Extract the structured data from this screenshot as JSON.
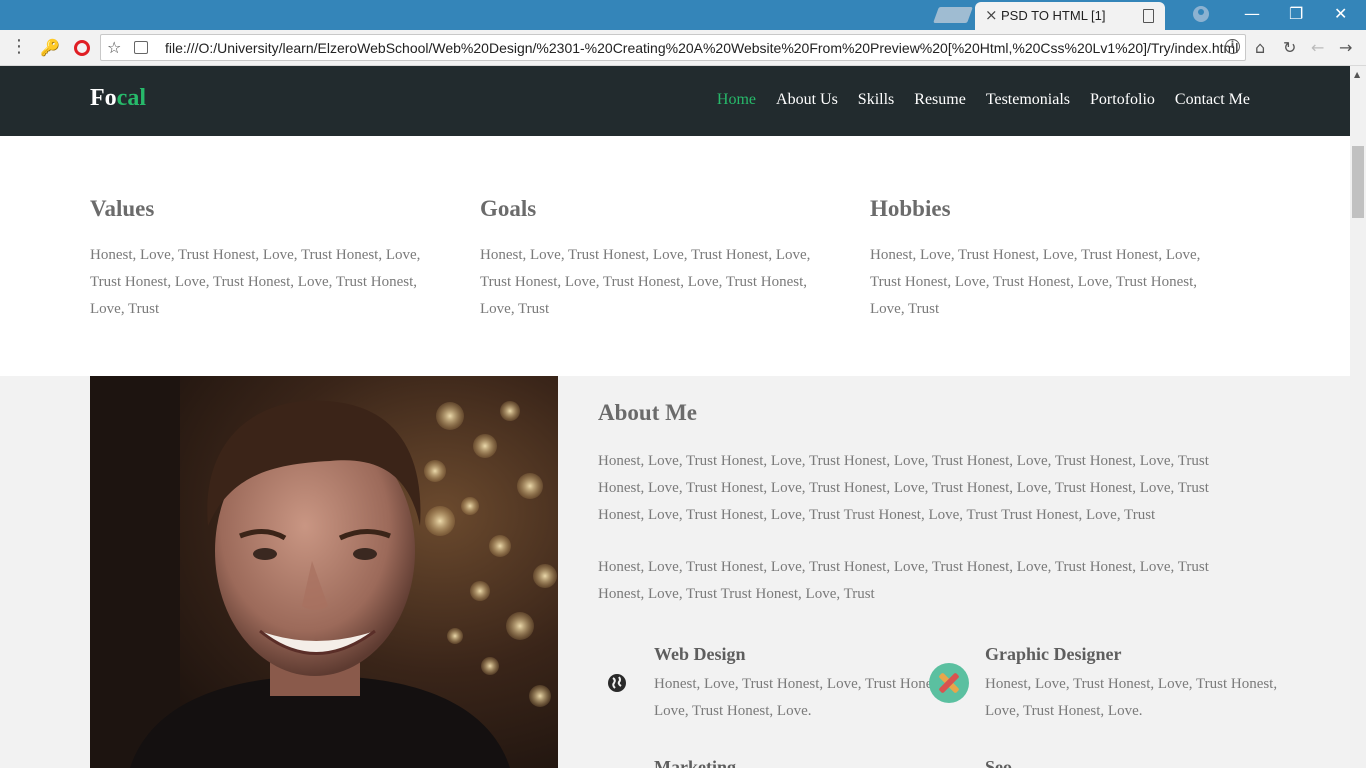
{
  "browser": {
    "tab_title": "PSD TO HTML [1]",
    "url": "file:///O:/University/learn/ElzeroWebSchool/Web%20Design/%2301-%20Creating%20A%20Website%20From%20Preview%20[%20Html,%20Css%20Lv1%20]/Try/index.html",
    "icons": [
      "menu-icon",
      "extension-key-icon",
      "opera-icon",
      "star-icon",
      "page-icon",
      "info-icon",
      "home-icon",
      "reload-icon",
      "back-icon",
      "forward-icon",
      "profile-icon",
      "minimize-icon",
      "maximize-icon",
      "close-icon"
    ]
  },
  "site": {
    "logo_part1": "Fo",
    "logo_part2": "cal",
    "accent_color": "#27b96a",
    "header_bg": "#222b2e",
    "nav": [
      {
        "label": "Home",
        "active": true
      },
      {
        "label": "About Us"
      },
      {
        "label": "Skills"
      },
      {
        "label": "Resume"
      },
      {
        "label": "Testemonials"
      },
      {
        "label": "Portofolio"
      },
      {
        "label": "Contact Me"
      }
    ]
  },
  "values": [
    {
      "title": "Values",
      "text": "Honest, Love, Trust Honest, Love, Trust Honest, Love, Trust Honest, Love, Trust Honest, Love, Trust Honest, Love, Trust"
    },
    {
      "title": "Goals",
      "text": "Honest, Love, Trust Honest, Love, Trust Honest, Love, Trust Honest, Love, Trust Honest, Love, Trust Honest, Love, Trust"
    },
    {
      "title": "Hobbies",
      "text": "Honest, Love, Trust Honest, Love, Trust Honest, Love, Trust Honest, Love, Trust Honest, Love, Trust Honest, Love, Trust"
    }
  ],
  "about": {
    "title": "About Me",
    "p1": "Honest, Love, Trust Honest, Love, Trust Honest, Love, Trust Honest, Love, Trust Honest, Love, Trust Honest, Love, Trust Honest, Love, Trust Honest, Love, Trust Honest, Love, Trust Honest, Love, Trust Honest, Love, Trust Honest, Love, Trust Trust Honest, Love, Trust Trust Honest, Love, Trust",
    "p2": "Honest, Love, Trust Honest, Love, Trust Honest, Love, Trust Honest, Love, Trust Honest, Love, Trust Honest, Love, Trust Trust Honest, Love, Trust"
  },
  "services": [
    {
      "title": "Web Design",
      "text": "Honest, Love, Trust Honest, Love, Trust Honest, Love, Trust Honest, Love.",
      "icon": "globe-icon"
    },
    {
      "title": "Graphic Designer",
      "text": "Honest, Love, Trust Honest, Love, Trust Honest, Love, Trust Honest, Love.",
      "icon": "pencil-tools-icon"
    },
    {
      "title": "Marketing",
      "icon": ""
    },
    {
      "title": "Seo",
      "icon": ""
    }
  ]
}
